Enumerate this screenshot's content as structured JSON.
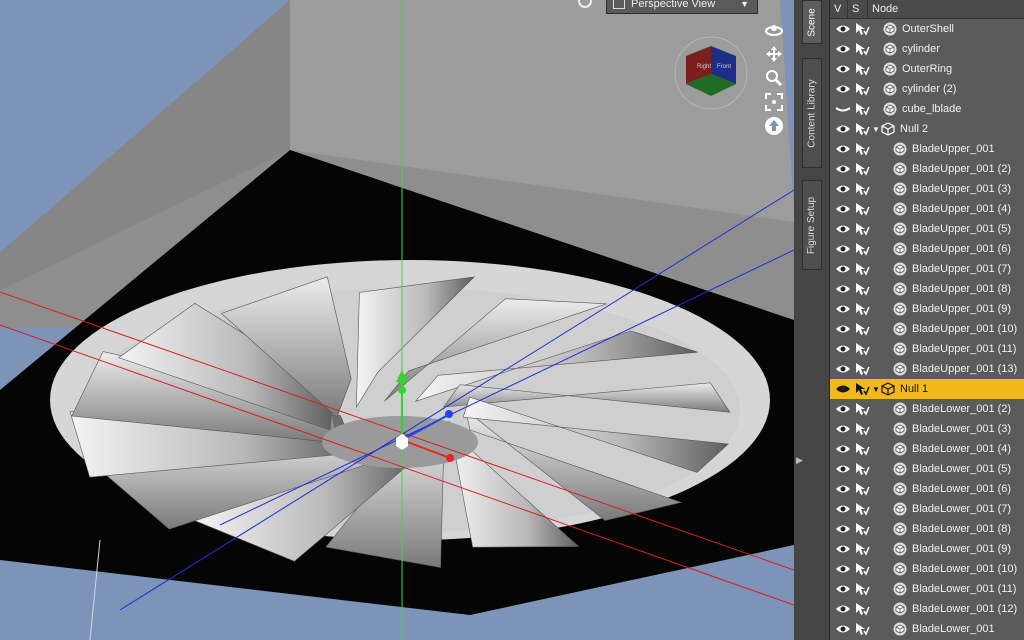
{
  "viewport": {
    "view_label": "Perspective View",
    "navcube_faces": [
      "Right",
      "Front"
    ],
    "tools": [
      "orbit-icon",
      "pan-icon",
      "zoom-icon",
      "frame-icon",
      "home-icon"
    ]
  },
  "side_tabs": [
    {
      "label": "Scene",
      "active": true
    },
    {
      "label": "Content Library",
      "active": false
    },
    {
      "label": "Figure Setup",
      "active": false
    }
  ],
  "scene": {
    "columns": {
      "v": "V",
      "s": "S",
      "node": "Node"
    },
    "rows": [
      {
        "label": "OuterShell",
        "type": "object",
        "level": 0,
        "visible": true
      },
      {
        "label": "cylinder",
        "type": "object",
        "level": 0,
        "visible": true
      },
      {
        "label": "OuterRing",
        "type": "object",
        "level": 0,
        "visible": true
      },
      {
        "label": "cylinder (2)",
        "type": "object",
        "level": 0,
        "visible": true
      },
      {
        "label": "cube_lblade",
        "type": "object",
        "level": 0,
        "visible": false
      },
      {
        "label": "Null 2",
        "type": "null",
        "level": 0,
        "visible": true,
        "expanded": true
      },
      {
        "label": "BladeUpper_001",
        "type": "object",
        "level": 1,
        "visible": true
      },
      {
        "label": "BladeUpper_001 (2)",
        "type": "object",
        "level": 1,
        "visible": true
      },
      {
        "label": "BladeUpper_001 (3)",
        "type": "object",
        "level": 1,
        "visible": true
      },
      {
        "label": "BladeUpper_001 (4)",
        "type": "object",
        "level": 1,
        "visible": true
      },
      {
        "label": "BladeUpper_001 (5)",
        "type": "object",
        "level": 1,
        "visible": true
      },
      {
        "label": "BladeUpper_001 (6)",
        "type": "object",
        "level": 1,
        "visible": true
      },
      {
        "label": "BladeUpper_001 (7)",
        "type": "object",
        "level": 1,
        "visible": true
      },
      {
        "label": "BladeUpper_001 (8)",
        "type": "object",
        "level": 1,
        "visible": true
      },
      {
        "label": "BladeUpper_001 (9)",
        "type": "object",
        "level": 1,
        "visible": true
      },
      {
        "label": "BladeUpper_001 (10)",
        "type": "object",
        "level": 1,
        "visible": true
      },
      {
        "label": "BladeUpper_001 (11)",
        "type": "object",
        "level": 1,
        "visible": true
      },
      {
        "label": "BladeUpper_001 (13)",
        "type": "object",
        "level": 1,
        "visible": true
      },
      {
        "label": "Null 1",
        "type": "null",
        "level": 0,
        "visible": true,
        "expanded": true,
        "selected": true
      },
      {
        "label": "BladeLower_001 (2)",
        "type": "object",
        "level": 1,
        "visible": true
      },
      {
        "label": "BladeLower_001 (3)",
        "type": "object",
        "level": 1,
        "visible": true
      },
      {
        "label": "BladeLower_001 (4)",
        "type": "object",
        "level": 1,
        "visible": true
      },
      {
        "label": "BladeLower_001 (5)",
        "type": "object",
        "level": 1,
        "visible": true
      },
      {
        "label": "BladeLower_001 (6)",
        "type": "object",
        "level": 1,
        "visible": true
      },
      {
        "label": "BladeLower_001 (7)",
        "type": "object",
        "level": 1,
        "visible": true
      },
      {
        "label": "BladeLower_001 (8)",
        "type": "object",
        "level": 1,
        "visible": true
      },
      {
        "label": "BladeLower_001 (9)",
        "type": "object",
        "level": 1,
        "visible": true
      },
      {
        "label": "BladeLower_001 (10)",
        "type": "object",
        "level": 1,
        "visible": true
      },
      {
        "label": "BladeLower_001 (11)",
        "type": "object",
        "level": 1,
        "visible": true
      },
      {
        "label": "BladeLower_001 (12)",
        "type": "object",
        "level": 1,
        "visible": true
      },
      {
        "label": "BladeLower_001",
        "type": "object",
        "level": 1,
        "visible": true
      }
    ]
  },
  "colors": {
    "viewport_bg": "#7d93b7",
    "selection": "#f3b91a",
    "panel_bg": "#5b5b5b"
  }
}
